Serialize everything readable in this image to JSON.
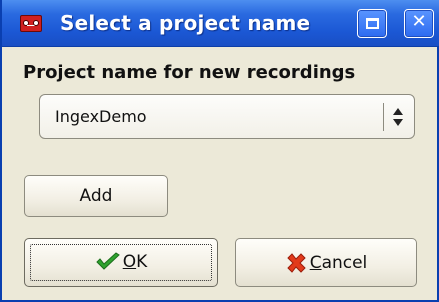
{
  "window": {
    "title": "Select a project name",
    "icon": "recorder-icon",
    "close_glyph": "✕"
  },
  "form": {
    "heading": "Project name for new recordings",
    "project_select_value": "IngexDemo"
  },
  "buttons": {
    "add": "Add",
    "ok_mnemonic": "O",
    "ok_rest": "K",
    "cancel_mnemonic": "C",
    "cancel_rest": "ancel"
  },
  "colors": {
    "titlebar": "#2a6ae0",
    "ok_check": "#2fa32f",
    "cancel_cross": "#e23a1a"
  }
}
